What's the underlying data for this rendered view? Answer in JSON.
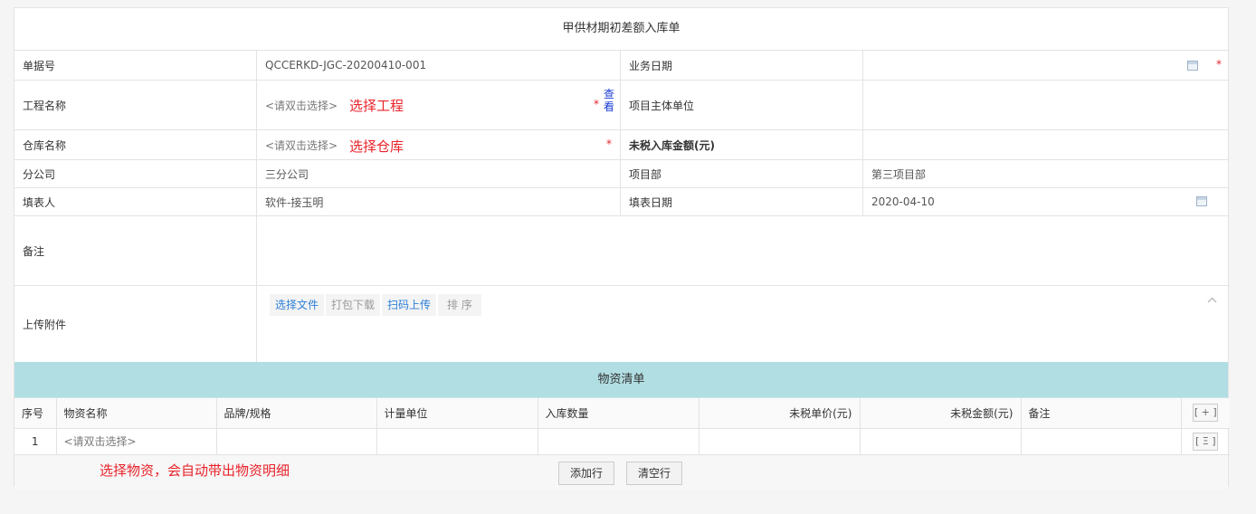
{
  "form": {
    "title": "甲供材期初差额入库单",
    "fields": {
      "doc_no_label": "单据号",
      "doc_no_value": "QCCERKD-JGC-20200410-001",
      "biz_date_label": "业务日期",
      "biz_date_value": "",
      "project_label": "工程名称",
      "project_placeholder": "<请双击选择>",
      "project_view_link_1": "查",
      "project_view_link_2": "看",
      "project_owner_label": "项目主体单位",
      "project_owner_value": "",
      "warehouse_label": "仓库名称",
      "warehouse_placeholder": "<请双击选择>",
      "untaxed_amount_label": "未税入库金额(元)",
      "untaxed_amount_value": "",
      "branch_label": "分公司",
      "branch_value": "三分公司",
      "dept_label": "项目部",
      "dept_value": "第三项目部",
      "filler_label": "填表人",
      "filler_value": "软件-接玉明",
      "fill_date_label": "填表日期",
      "fill_date_value": "2020-04-10",
      "remark_label": "备注",
      "remark_value": "",
      "attach_label": "上传附件"
    },
    "required_mark": "*",
    "attach_buttons": {
      "select_file": "选择文件",
      "pack_download": "打包下载",
      "scan_upload": "扫码上传",
      "sort": "排 序"
    }
  },
  "annotations": {
    "project_hint": "选择工程",
    "warehouse_hint": "选择仓库",
    "material_hint": "选择物资，会自动带出物资明细"
  },
  "materials": {
    "section_title": "物资清单",
    "columns": [
      "序号",
      "物资名称",
      "品牌/规格",
      "计量单位",
      "入库数量",
      "未税单价(元)",
      "未税金额(元)",
      "备注"
    ],
    "add_col_button": "[ + ]",
    "rows": [
      {
        "index": "1",
        "name_placeholder": "<请双击选择>",
        "row_menu_button": "[ Ξ ]"
      }
    ],
    "add_row_button": "添加行",
    "clear_rows_button": "清空行"
  },
  "icons": {
    "date_picker": "calendar-icon",
    "collapse": "chevron-up-icon"
  },
  "colors": {
    "annotation_red": "#e8232a",
    "section_bar": "#b1dee3",
    "link_blue": "#2b7fd6"
  }
}
